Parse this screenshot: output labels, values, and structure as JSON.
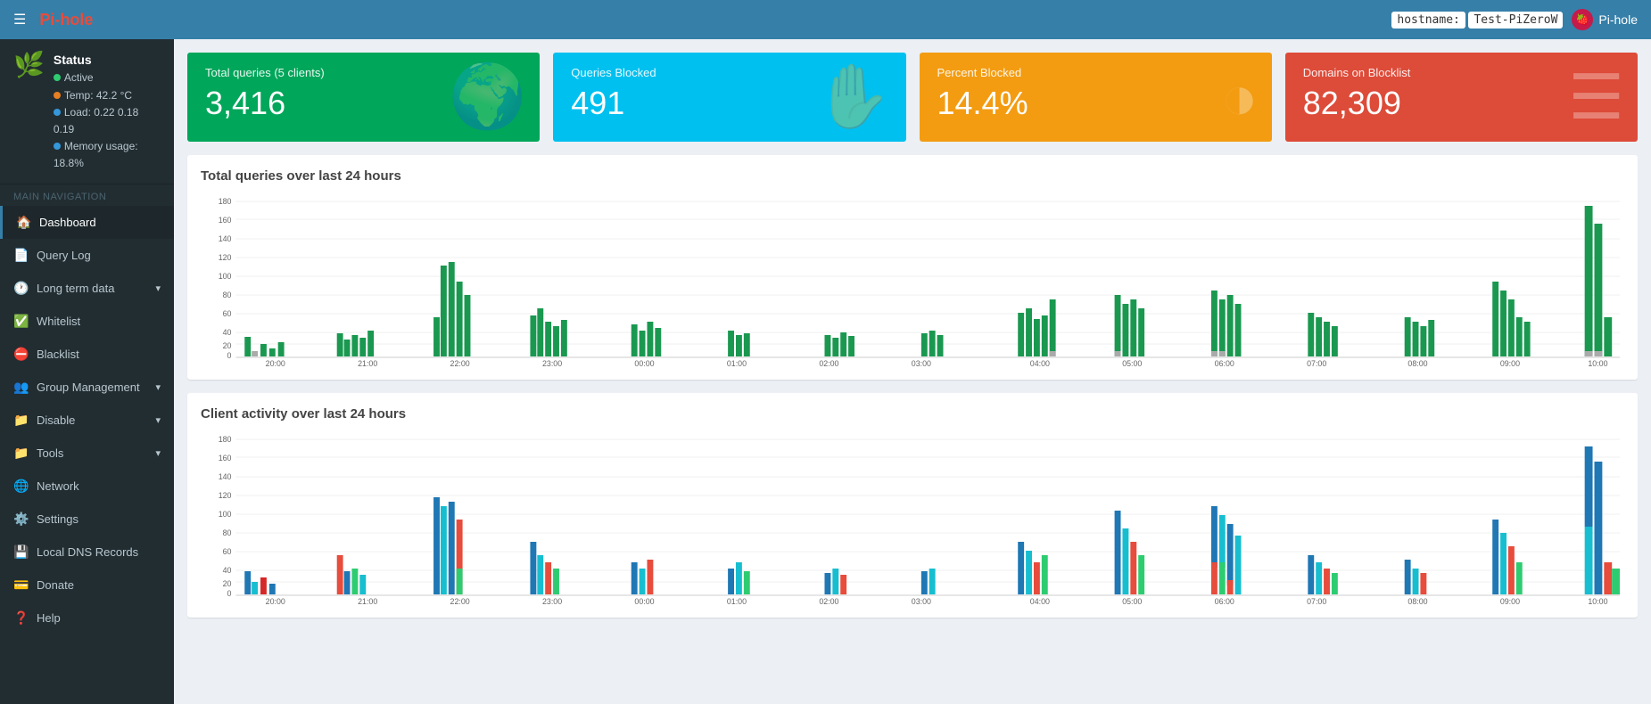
{
  "navbar": {
    "logo_text": "Pi-",
    "logo_bold": "hole",
    "hamburger": "☰",
    "hostname_label": "hostname:",
    "hostname_value": "Test-PiZeroW",
    "pihole_label": "Pi-hole"
  },
  "sidebar": {
    "status_title": "Status",
    "status_active": "Active",
    "status_temp": "Temp: 42.2 °C",
    "status_load": "Load: 0.22  0.18  0.19",
    "status_memory": "Memory usage: 18.8%",
    "nav_header": "MAIN NAVIGATION",
    "nav_items": [
      {
        "label": "Dashboard",
        "icon": "🏠",
        "active": true
      },
      {
        "label": "Query Log",
        "icon": "📄",
        "active": false
      },
      {
        "label": "Long term data",
        "icon": "🕐",
        "active": false,
        "arrow": true
      },
      {
        "label": "Whitelist",
        "icon": "✅",
        "active": false
      },
      {
        "label": "Blacklist",
        "icon": "⛔",
        "active": false
      },
      {
        "label": "Group Management",
        "icon": "👥",
        "active": false,
        "arrow": true
      },
      {
        "label": "Disable",
        "icon": "📁",
        "active": false,
        "arrow": true
      },
      {
        "label": "Tools",
        "icon": "📁",
        "active": false,
        "arrow": true
      },
      {
        "label": "Network",
        "icon": "🌐",
        "active": false
      },
      {
        "label": "Settings",
        "icon": "⚙️",
        "active": false
      },
      {
        "label": "Local DNS Records",
        "icon": "💾",
        "active": false
      },
      {
        "label": "Donate",
        "icon": "💳",
        "active": false
      },
      {
        "label": "Help",
        "icon": "❓",
        "active": false
      }
    ]
  },
  "stats": {
    "total_queries_label": "Total queries (5 clients)",
    "total_queries_value": "3,416",
    "queries_blocked_label": "Queries Blocked",
    "queries_blocked_value": "491",
    "percent_blocked_label": "Percent Blocked",
    "percent_blocked_value": "14.4%",
    "domains_blocklist_label": "Domains on Blocklist",
    "domains_blocklist_value": "82,309"
  },
  "charts": {
    "queries_title": "Total queries over last 24 hours",
    "clients_title": "Client activity over last 24 hours",
    "time_labels": [
      "20:00",
      "21:00",
      "22:00",
      "23:00",
      "00:00",
      "01:00",
      "02:00",
      "03:00",
      "04:00",
      "05:00",
      "06:00",
      "07:00",
      "08:00",
      "09:00",
      "10:00"
    ],
    "y_labels": [
      0,
      20,
      40,
      60,
      80,
      100,
      120,
      140,
      160,
      180
    ]
  }
}
